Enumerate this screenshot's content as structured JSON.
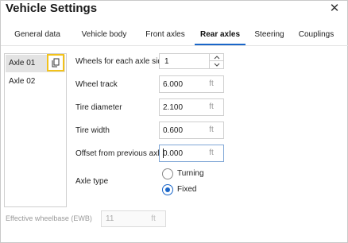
{
  "dialog": {
    "title": "Vehicle Settings",
    "close_icon": "close-icon",
    "close_glyph": "✕"
  },
  "tabs": [
    {
      "label": "General data",
      "active": false
    },
    {
      "label": "Vehicle body",
      "active": false
    },
    {
      "label": "Front axles",
      "active": false
    },
    {
      "label": "Rear axles",
      "active": true
    },
    {
      "label": "Steering",
      "active": false
    },
    {
      "label": "Couplings",
      "active": false
    }
  ],
  "axles": {
    "items": [
      {
        "label": "Axle 01",
        "selected": true
      },
      {
        "label": "Axle 02",
        "selected": false
      }
    ],
    "copy_icon": "copy-icon",
    "highlight_color": "#f2c21b"
  },
  "form": {
    "wheels_label": "Wheels for each axle side",
    "wheels_value": "1",
    "wheel_track_label": "Wheel track",
    "wheel_track_value": "6.000",
    "wheel_track_unit": "ft",
    "tire_diameter_label": "Tire diameter",
    "tire_diameter_value": "2.100",
    "tire_diameter_unit": "ft",
    "tire_width_label": "Tire width",
    "tire_width_value": "0.600",
    "tire_width_unit": "ft",
    "offset_label": "Offset from previous axle",
    "offset_value": "0.000",
    "offset_unit": "ft",
    "axle_type_label": "Axle type",
    "axle_type_options": [
      {
        "label": "Turning",
        "selected": false
      },
      {
        "label": "Fixed",
        "selected": true
      }
    ]
  },
  "ewb": {
    "label": "Effective wheelbase (EWB)",
    "value": "11",
    "unit": "ft"
  },
  "colors": {
    "accent": "#1a66c9",
    "highlight": "#f2c21b"
  }
}
